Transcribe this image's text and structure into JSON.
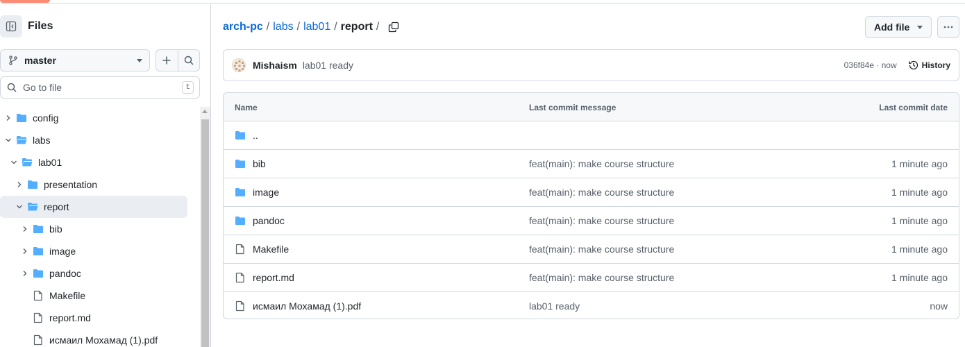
{
  "sidebar": {
    "title": "Files",
    "branch": "master",
    "search_placeholder": "Go to file",
    "search_shortcut": "t",
    "tree": [
      {
        "label": "config",
        "kind": "folder",
        "expanded": false,
        "depth": 0
      },
      {
        "label": "labs",
        "kind": "folder",
        "expanded": true,
        "depth": 0
      },
      {
        "label": "lab01",
        "kind": "folder",
        "expanded": true,
        "depth": 1
      },
      {
        "label": "presentation",
        "kind": "folder",
        "expanded": false,
        "depth": 2
      },
      {
        "label": "report",
        "kind": "folder",
        "expanded": true,
        "depth": 2,
        "selected": true
      },
      {
        "label": "bib",
        "kind": "folder",
        "expanded": false,
        "depth": 3
      },
      {
        "label": "image",
        "kind": "folder",
        "expanded": false,
        "depth": 3
      },
      {
        "label": "pandoc",
        "kind": "folder",
        "expanded": false,
        "depth": 3
      },
      {
        "label": "Makefile",
        "kind": "file",
        "depth": 3
      },
      {
        "label": "report.md",
        "kind": "file",
        "depth": 3
      },
      {
        "label": "исмаил Мохамад (1).pdf",
        "kind": "file",
        "depth": 3
      }
    ]
  },
  "breadcrumb": {
    "root": "arch-pc",
    "parts": [
      "labs",
      "lab01"
    ],
    "current": "report",
    "trailing_sep": "/",
    "sep": "/"
  },
  "toolbar": {
    "add_file": "Add file"
  },
  "commit": {
    "author": "Mishaism",
    "message": "lab01 ready",
    "sha_time": "036f84e · now",
    "history_label": "History"
  },
  "table": {
    "headers": {
      "name": "Name",
      "message": "Last commit message",
      "date": "Last commit date"
    },
    "rows": [
      {
        "kind": "folder",
        "name": "..",
        "message": "",
        "date": ""
      },
      {
        "kind": "folder",
        "name": "bib",
        "message": "feat(main): make course structure",
        "date": "1 minute ago"
      },
      {
        "kind": "folder",
        "name": "image",
        "message": "feat(main): make course structure",
        "date": "1 minute ago"
      },
      {
        "kind": "folder",
        "name": "pandoc",
        "message": "feat(main): make course structure",
        "date": "1 minute ago"
      },
      {
        "kind": "file",
        "name": "Makefile",
        "message": "feat(main): make course structure",
        "date": "1 minute ago"
      },
      {
        "kind": "file",
        "name": "report.md",
        "message": "feat(main): make course structure",
        "date": "1 minute ago"
      },
      {
        "kind": "file",
        "name": "исмаил Мохамад (1).pdf",
        "message": "lab01 ready",
        "date": "now"
      }
    ]
  },
  "colors": {
    "accent_link": "#0969da",
    "folder": "#54aeff",
    "border": "#d0d7de",
    "muted_text": "#57606a",
    "tab_underline": "#fd8c73"
  },
  "icons": {
    "sidebar_toggle": "sidebar-collapse-icon",
    "branch": "git-branch-icon",
    "add": "plus-icon",
    "search": "search-icon",
    "copy": "copy-icon",
    "more": "kebab-horizontal-icon",
    "history": "history-icon",
    "folder": "folder-icon",
    "file": "file-icon"
  }
}
